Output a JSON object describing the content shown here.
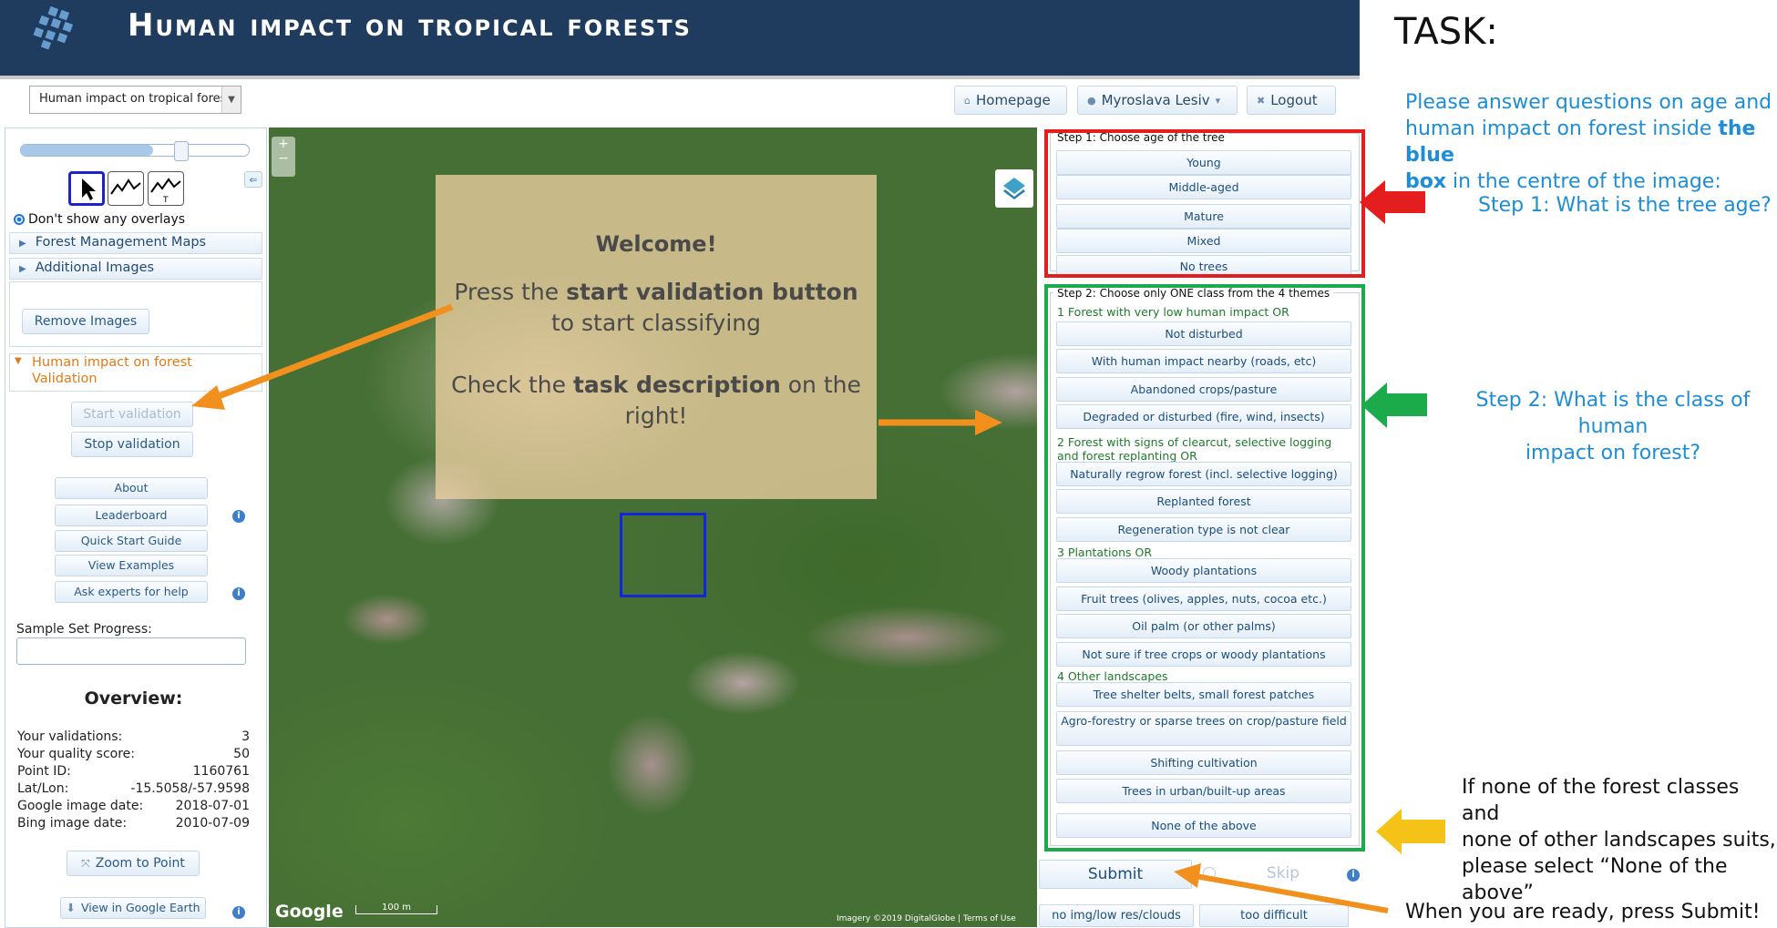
{
  "header": {
    "title": "Human impact on tropical forests"
  },
  "toolbar": {
    "project_select": "Human impact on tropical forest",
    "homepage": "Homepage",
    "user": "Myroslava Lesiv",
    "logout": "Logout"
  },
  "left_panel": {
    "overlay_radio": "Don't show any overlays",
    "forest_maps": "Forest Management Maps",
    "additional_images": "Additional Images",
    "remove_images": "Remove Images",
    "section_title": "Human impact on forest Validation",
    "start_validation": "Start validation",
    "stop_validation": "Stop validation",
    "about": "About",
    "leaderboard": "Leaderboard",
    "quick_start": "Quick Start Guide",
    "view_examples": "View Examples",
    "ask_experts": "Ask experts for help",
    "progress_label": "Sample Set Progress:",
    "overview_title": "Overview:",
    "stats": [
      {
        "label": "Your validations:",
        "value": "3"
      },
      {
        "label": "Your quality score:",
        "value": "50"
      },
      {
        "label": "Point ID:",
        "value": "1160761"
      },
      {
        "label": "Lat/Lon:",
        "value": "-15.5058/-57.9598"
      },
      {
        "label": "Google image date:",
        "value": "2018-07-01"
      },
      {
        "label": "Bing image date:",
        "value": "2010-07-09"
      }
    ],
    "zoom_to_point": "Zoom to Point",
    "view_google_earth": "View in Google Earth"
  },
  "map": {
    "welcome_title": "Welcome!",
    "welcome_l1_a": "Press the ",
    "welcome_l1_b": "start validation button",
    "welcome_l2": "to start classifying",
    "welcome_l3_a": "Check the ",
    "welcome_l3_b": "task description",
    "welcome_l3_c": " on the",
    "welcome_l4": "right!",
    "google": "Google",
    "scale": "100 m",
    "attribution": "Imagery ©2019 DigitalGlobe | Terms of Use"
  },
  "step1": {
    "legend": "Step 1: Choose age of the tree",
    "options": [
      "Young",
      "Middle-aged",
      "Mature",
      "Mixed",
      "No trees"
    ]
  },
  "step2": {
    "legend": "Step 2: Choose only ONE class from the 4 themes",
    "theme1": "1 Forest with very low human impact OR",
    "t1": [
      "Not disturbed",
      "With human impact nearby (roads, etc)",
      "Abandoned crops/pasture",
      "Degraded or disturbed (fire, wind, insects)"
    ],
    "theme2": "2 Forest with signs of clearcut, selective logging and forest replanting OR",
    "t2": [
      "Naturally regrow forest (incl. selective logging)",
      "Replanted forest",
      "Regeneration type is not clear"
    ],
    "theme3": "3 Plantations OR",
    "t3": [
      "Woody plantations",
      "Fruit trees (olives, apples, nuts, cocoa etc.)",
      "Oil palm (or other palms)",
      "Not sure if tree crops or woody plantations"
    ],
    "theme4": "4 Other landscapes",
    "t4": [
      "Tree shelter belts, small forest patches",
      "Agro-forestry or sparse trees on crop/pasture field",
      "Shifting cultivation",
      "Trees in urban/built-up areas"
    ],
    "none": "None of the above"
  },
  "actions": {
    "submit": "Submit",
    "skip": "Skip",
    "no_img": "no img/low res/clouds",
    "too_difficult": "too difficult"
  },
  "task": {
    "title": "TASK:",
    "intro_a": "Please answer  questions on age and",
    "intro_b": "human impact on forest inside ",
    "intro_b_bold": "the blue",
    "intro_c_bold": "box",
    "intro_c": " in the centre of the image:",
    "step1": "Step 1: What is the tree age?",
    "step2_a": "Step 2: What is the class of human",
    "step2_b": "impact on forest?",
    "none_a": "If none of the forest classes and",
    "none_b": "none of other landscapes suits,",
    "none_c": "please select “None  of the above”",
    "submit_hint": "When you are ready, press Submit!"
  },
  "colors": {
    "header": "#1f3c5e",
    "red_box": "#e41e1e",
    "green_box": "#1bab4b",
    "blue_box": "#1228d8",
    "orange_arrow": "#f2901e",
    "yellow_arrow": "#f5c218",
    "task_blue": "#1d8ed6"
  }
}
